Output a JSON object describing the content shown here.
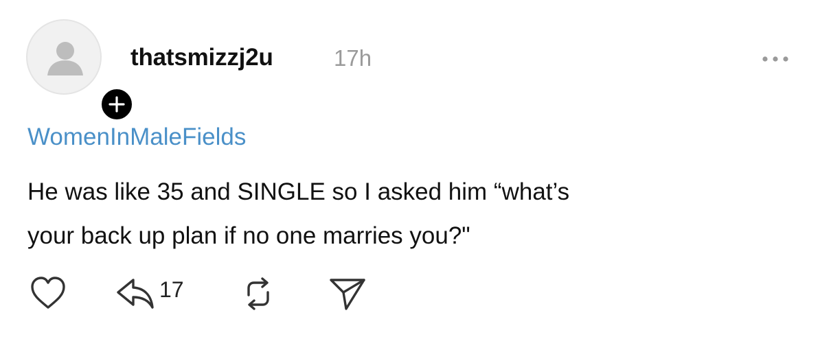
{
  "post": {
    "username": "thatsmizzj2u",
    "time": "17h",
    "community": "WomenInMaleFields",
    "body_lines": [
      "He was like 35 and SINGLE so I asked him “what’s",
      "your back up plan if no one marries you?\""
    ],
    "reply_count": "17"
  },
  "icons": {
    "avatar": "default-user-avatar",
    "follow": "plus-icon",
    "more": "more-horizontal-icon",
    "like": "heart-icon",
    "reply": "reply-arrow-icon",
    "repost": "repost-icon",
    "share": "send-icon"
  },
  "colors": {
    "community_link": "#4a90c8",
    "timestamp": "#9a9a9a",
    "icon": "#333333"
  }
}
